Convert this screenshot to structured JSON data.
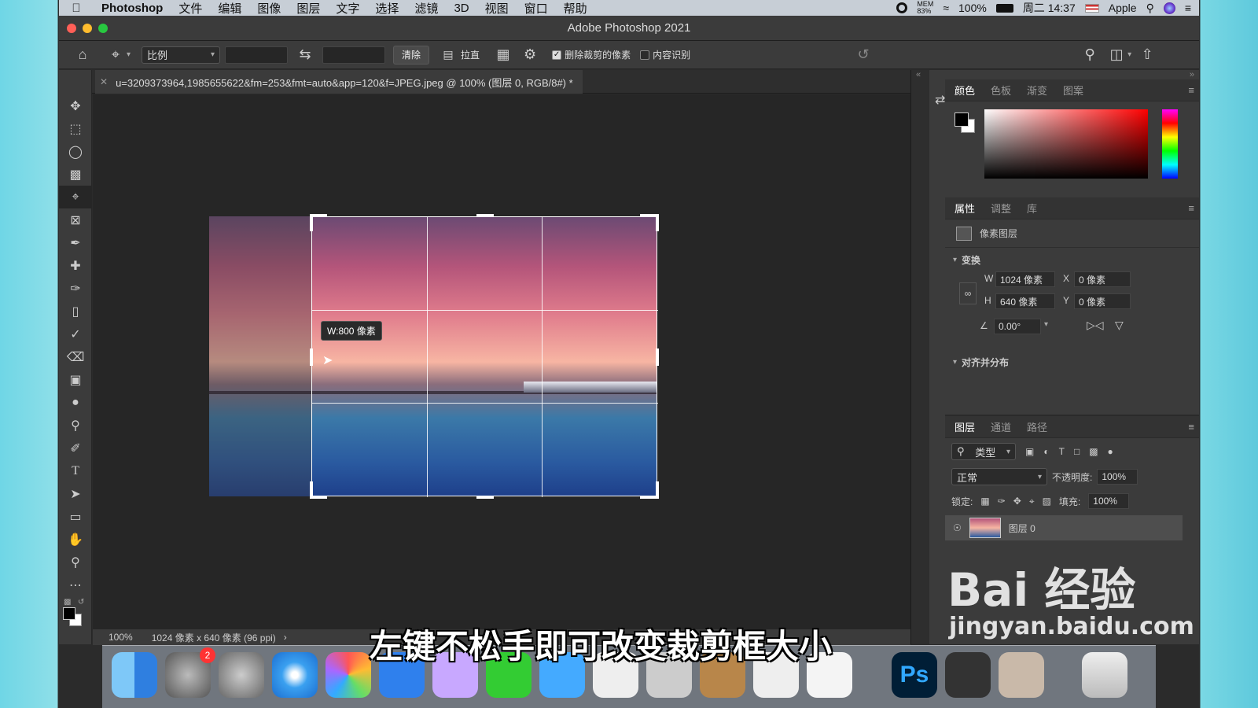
{
  "menubar": {
    "app_name": "Photoshop",
    "items": [
      "文件",
      "编辑",
      "图像",
      "图层",
      "文字",
      "选择",
      "滤镜",
      "3D",
      "视图",
      "窗口",
      "帮助"
    ],
    "mem_label": "MEM",
    "mem_value": "83%",
    "battery": "100%",
    "clock": "周二 14:37",
    "user": "Apple"
  },
  "window": {
    "title": "Adobe Photoshop 2021"
  },
  "optbar": {
    "ratio_label": "比例",
    "clear_label": "清除",
    "straighten_label": "拉直",
    "delete_cropped_label": "删除裁剪的像素",
    "delete_cropped_checked": true,
    "content_aware_label": "内容识别",
    "content_aware_checked": false
  },
  "document": {
    "tab_title": "u=3209373964,1985655622&fm=253&fmt=auto&app=120&f=JPEG.jpeg @ 100% (图层 0, RGB/8#) *"
  },
  "canvas": {
    "tooltip": "W:800 像素"
  },
  "status": {
    "zoom": "100%",
    "doc_info": "1024 像素 x 640 像素 (96 ppi)"
  },
  "color_panel": {
    "tabs": [
      "颜色",
      "色板",
      "渐变",
      "图案"
    ]
  },
  "properties_panel": {
    "tabs": [
      "属性",
      "调整",
      "库"
    ],
    "layer_type": "像素图层",
    "transform_heading": "变换",
    "w_label": "W",
    "w_value": "1024 像素",
    "h_label": "H",
    "h_value": "640 像素",
    "x_label": "X",
    "x_value": "0 像素",
    "y_label": "Y",
    "y_value": "0 像素",
    "angle_value": "0.00°",
    "align_heading": "对齐并分布"
  },
  "layers_panel": {
    "tabs": [
      "图层",
      "通道",
      "路径"
    ],
    "filter_label": "类型",
    "blend_mode": "正常",
    "opacity_label": "不透明度:",
    "opacity_value": "100%",
    "lock_label": "锁定:",
    "fill_label": "填充:",
    "fill_value": "100%",
    "layer_name": "图层 0"
  },
  "dock": {
    "ps_label": "Ps",
    "badge_count": "2"
  },
  "overlay": {
    "subtitle": "左键不松手即可改变裁剪框大小",
    "watermark_main": "Bai 经验",
    "watermark_sub": "jingyan.baidu.com"
  }
}
